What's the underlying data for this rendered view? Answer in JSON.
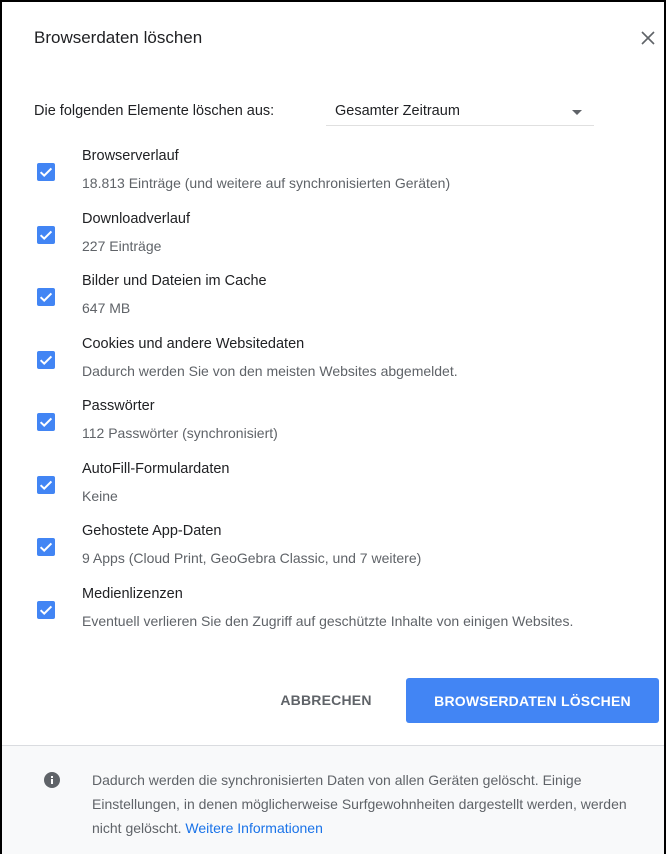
{
  "dialog": {
    "title": "Browserdaten löschen",
    "close_icon": "close-icon"
  },
  "range": {
    "label": "Die folgenden Elemente löschen aus:",
    "selected": "Gesamter Zeitraum"
  },
  "items": [
    {
      "label": "Browserverlauf",
      "sub": "18.813 Einträge (und weitere auf synchronisierten Geräten)",
      "checked": true
    },
    {
      "label": "Downloadverlauf",
      "sub": "227 Einträge",
      "checked": true
    },
    {
      "label": "Bilder und Dateien im Cache",
      "sub": "647 MB",
      "checked": true
    },
    {
      "label": "Cookies und andere Websitedaten",
      "sub": "Dadurch werden Sie von den meisten Websites abgemeldet.",
      "checked": true
    },
    {
      "label": "Passwörter",
      "sub": "112 Passwörter (synchronisiert)",
      "checked": true
    },
    {
      "label": "AutoFill-Formulardaten",
      "sub": "Keine",
      "checked": true
    },
    {
      "label": "Gehostete App-Daten",
      "sub": "9 Apps (Cloud Print, GeoGebra Classic, und 7 weitere)",
      "checked": true
    },
    {
      "label": "Medienlizenzen",
      "sub": "Eventuell verlieren Sie den Zugriff auf geschützte Inhalte von einigen Websites.",
      "checked": true
    }
  ],
  "buttons": {
    "cancel": "ABBRECHEN",
    "clear": "BROWSERDATEN LÖSCHEN"
  },
  "footer": {
    "info_icon": "info-icon",
    "text": "Dadurch werden die synchronisierten Daten von allen Geräten gelöscht. Einige Einstellungen, in denen möglicherweise Surfgewohnheiten dargestellt werden, werden nicht gelöscht.",
    "link": "Weitere Informationen"
  },
  "colors": {
    "accent": "#4285f4",
    "text_primary": "#202124",
    "text_secondary": "#5f6368",
    "link": "#1a73e8",
    "footer_bg": "#f8f9fa"
  }
}
